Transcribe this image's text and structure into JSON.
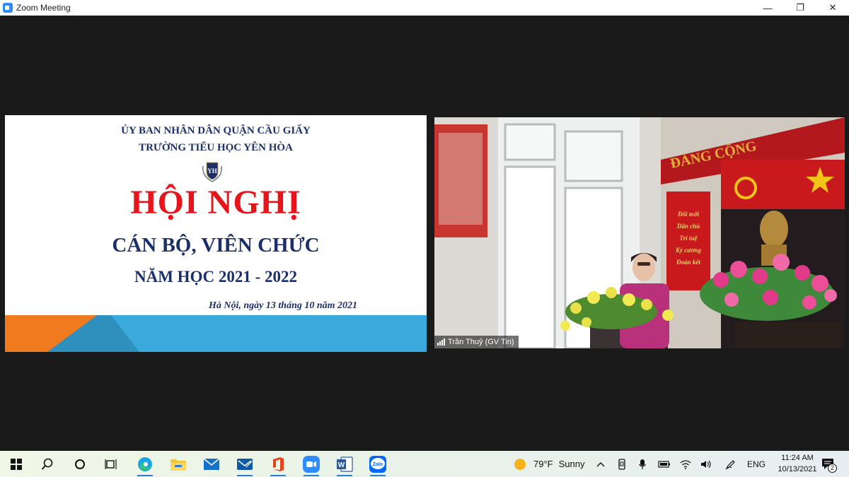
{
  "window": {
    "title": "Zoom Meeting",
    "minimize_glyph": "—",
    "restore_glyph": "❐",
    "close_glyph": "✕"
  },
  "slide": {
    "line1": "ỦY BAN NHÂN DÂN QUẬN CẦU GIẤY",
    "line2": "TRƯỜNG TIỂU HỌC YÊN HÒA",
    "emblem_letters": "YH",
    "title": "HỘI NGHỊ",
    "subtitle": "CÁN BỘ, VIÊN CHỨC",
    "year": "NĂM HỌC 2021 - 2022",
    "date": "Hà Nội, ngày 13 tháng 10 năm 2021"
  },
  "video": {
    "participant_name": "Trần Thuỷ (GV Tin)",
    "banner_text": "ĐẢNG CỘNG",
    "slogans": [
      "Đổi mới",
      "Dân chủ",
      "Trí tuệ",
      "Kỷ cương",
      "Đoàn kết"
    ]
  },
  "taskbar": {
    "weather_temp": "79°F",
    "weather_desc": "Sunny",
    "language": "ENG",
    "time": "11:24 AM",
    "date": "10/13/2021",
    "notification_count": "2",
    "zalo_label": "Zalo",
    "word_label": "W"
  },
  "colors": {
    "zoom_blue": "#2d8cff",
    "slide_red": "#e8141c",
    "slide_navy": "#1b2f6b",
    "band_orange": "#f07a1e",
    "band_blue": "#3aa9dc"
  }
}
